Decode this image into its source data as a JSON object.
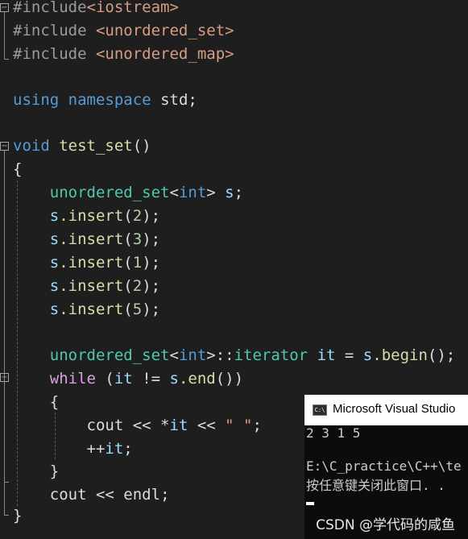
{
  "code": {
    "l1": {
      "hash": "#",
      "include": "include",
      "header": "<iostream>"
    },
    "l2": {
      "hash": "#",
      "include": "include",
      "header": "<unordered_set>"
    },
    "l3": {
      "hash": "#",
      "include": "include",
      "header": "<unordered_map>"
    },
    "l4": {
      "using": "using",
      "namespace": "namespace",
      "std": "std;"
    },
    "l5": {
      "void": "void",
      "name": "test_set",
      "parens": "()"
    },
    "l6": {
      "brace": "{"
    },
    "l7": {
      "type": "unordered_set",
      "open": "<",
      "int": "int",
      "close": ">",
      "var": "s",
      "semi": ";"
    },
    "inserts": [
      {
        "obj": "s",
        "call": ".insert",
        "open": "(",
        "arg": "2",
        "close": ");"
      },
      {
        "obj": "s",
        "call": ".insert",
        "open": "(",
        "arg": "3",
        "close": ");"
      },
      {
        "obj": "s",
        "call": ".insert",
        "open": "(",
        "arg": "1",
        "close": ");"
      },
      {
        "obj": "s",
        "call": ".insert",
        "open": "(",
        "arg": "2",
        "close": ");"
      },
      {
        "obj": "s",
        "call": ".insert",
        "open": "(",
        "arg": "5",
        "close": ");"
      }
    ],
    "l14": {
      "type": "unordered_set",
      "open": "<",
      "int": "int",
      "close": ">",
      "scope": "::",
      "iter": "iterator",
      "var": "it",
      "eq": " = ",
      "obj": "s",
      "call": ".begin",
      "tail": "();"
    },
    "l15": {
      "while": "while",
      "open": " (",
      "var": "it",
      "op": " != ",
      "obj": "s",
      "call": ".end",
      "tail": "())"
    },
    "l16": {
      "brace": "{"
    },
    "l17": {
      "cout": "cout",
      "op1": " << ",
      "deref": "*",
      "var": "it",
      "op2": " << ",
      "str": "\" \"",
      "semi": ";"
    },
    "l18": {
      "inc": "++",
      "var": "it",
      "semi": ";"
    },
    "l19": {
      "brace": "}"
    },
    "l20": {
      "cout": "cout",
      "op": " << ",
      "endl": "endl",
      "semi": ";"
    },
    "l21": {
      "brace": "}"
    }
  },
  "console": {
    "title": "Microsoft Visual Studio",
    "icon_text": "C:\\",
    "output": "2 3 1 5",
    "path": "E:\\C_practice\\C++\\te",
    "prompt": "按任意键关闭此窗口. ."
  },
  "watermark": "CSDN @学代码的咸鱼",
  "icons": {
    "fold_expanded": "minus-fold-icon",
    "console": "console-app-icon"
  },
  "colors": {
    "background": "#1e1e1e",
    "keyword": "#569cd6",
    "type": "#4ec9b0",
    "function": "#dcdcaa",
    "variable": "#9cdcfe",
    "number": "#b5cea8",
    "control": "#d8a0df",
    "string": "#d69d85",
    "preprocessor": "#9b9b9b"
  }
}
